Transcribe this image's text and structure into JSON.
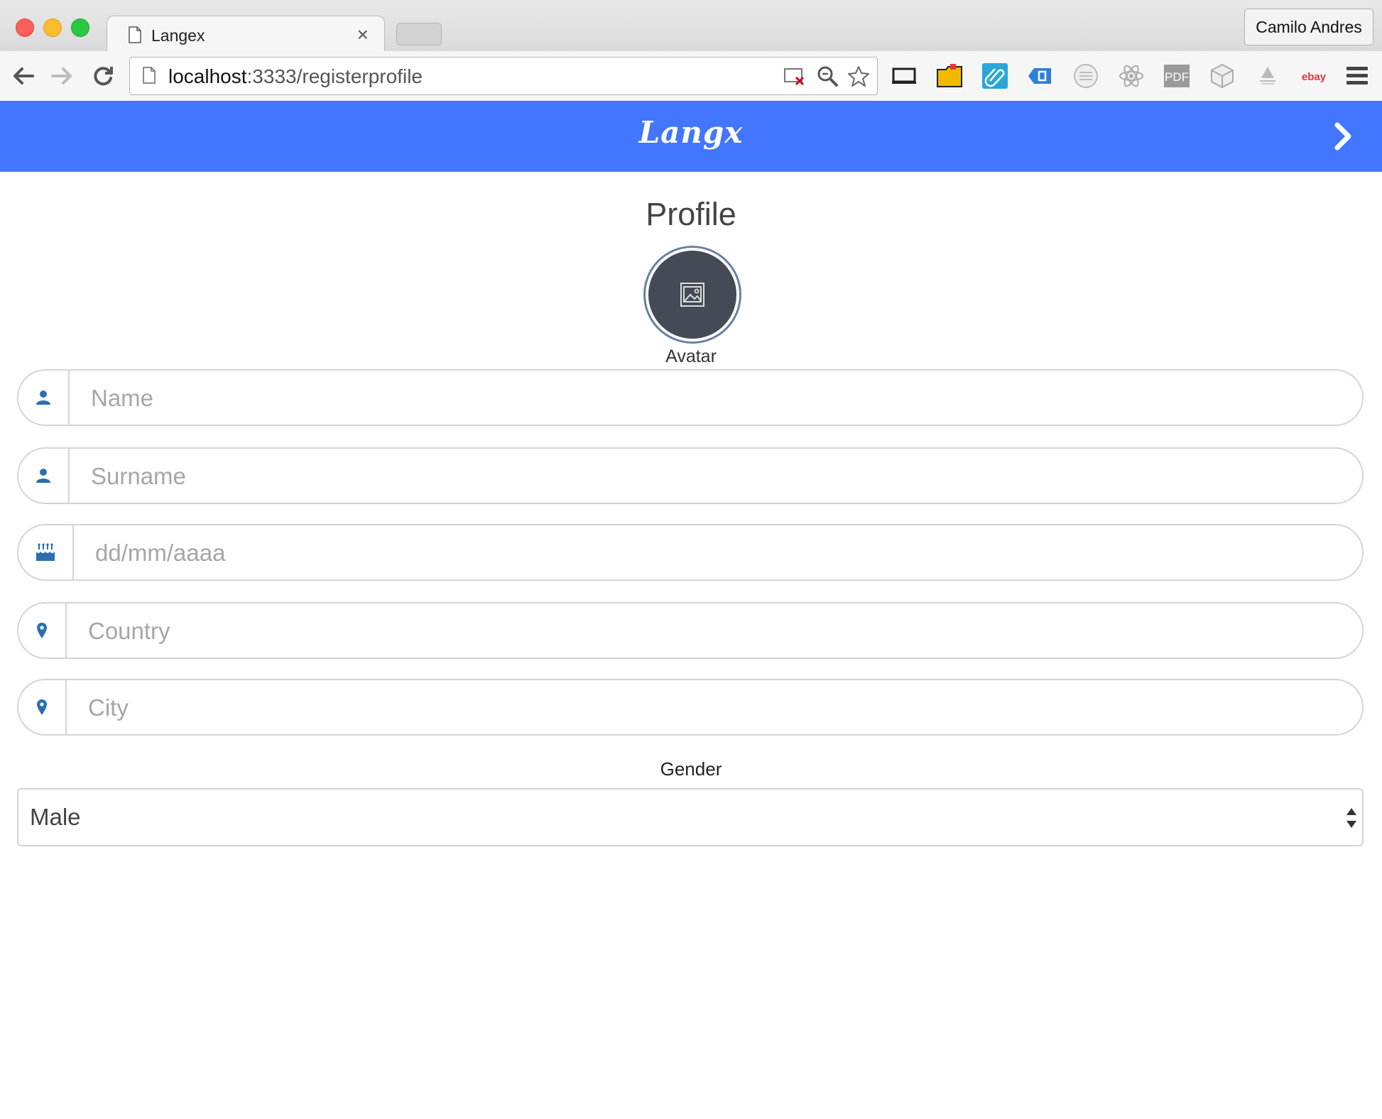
{
  "browser": {
    "tab_title": "Langex",
    "tab_close": "×",
    "profile_name": "Camilo Andres",
    "url_host": "localhost",
    "url_rest": ":3333/registerprofile"
  },
  "extensions": [
    "cast-icon",
    "folder-icon",
    "clip-icon",
    "tag-icon",
    "globe-icon",
    "react-icon",
    "pdf-icon",
    "cube-icon",
    "shield-icon",
    "ebay-icon"
  ],
  "extension_labels": {
    "pdf": "PDF",
    "ebay": "ebay"
  },
  "header": {
    "brand": "Langx"
  },
  "profile": {
    "title": "Profile",
    "avatar_label": "Avatar"
  },
  "fields": {
    "name_placeholder": "Name",
    "surname_placeholder": "Surname",
    "birthdate_placeholder": "dd/mm/aaaa",
    "country_placeholder": "Country",
    "city_placeholder": "City"
  },
  "gender": {
    "label": "Gender",
    "selected": "Male"
  },
  "colors": {
    "header_bg": "#4276fe",
    "icon_blue": "#2a6fb0",
    "avatar_bg": "#454a57"
  }
}
